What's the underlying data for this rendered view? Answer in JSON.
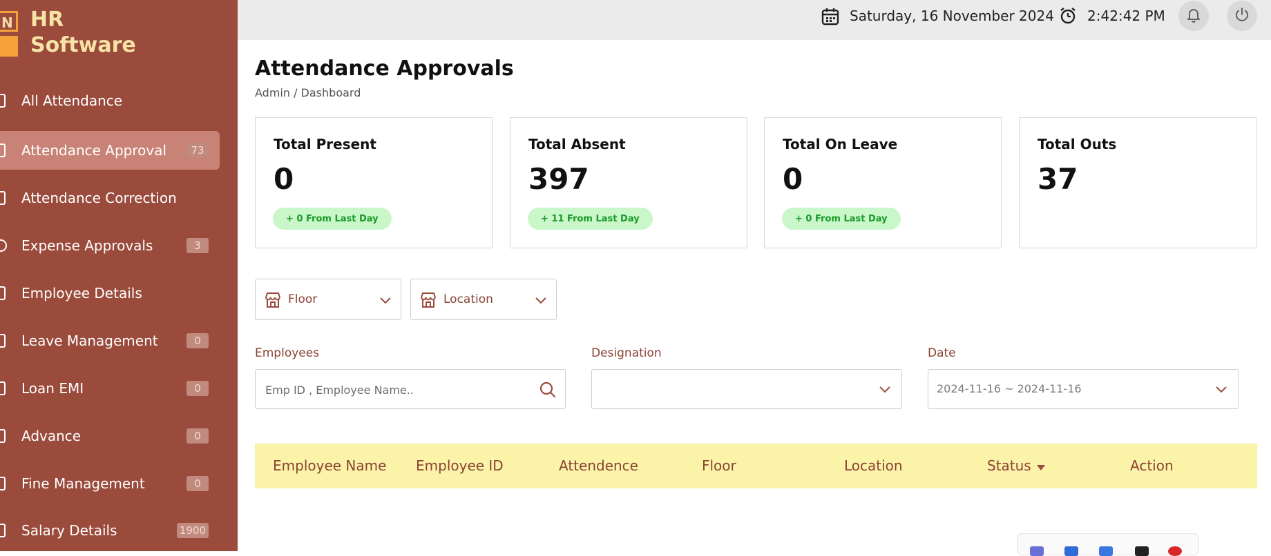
{
  "app": {
    "name_line1": "HR",
    "name_line2": "Software",
    "logo_letter": "N"
  },
  "sidebar": {
    "items": [
      {
        "label": "All Attendance",
        "badge": ""
      },
      {
        "label": "Attendance Approval",
        "badge": "73",
        "active": true
      },
      {
        "label": "Attendance Correction",
        "badge": ""
      },
      {
        "label": "Expense Approvals",
        "badge": "3"
      },
      {
        "label": "Employee Details",
        "badge": ""
      },
      {
        "label": "Leave Management",
        "badge": "0"
      },
      {
        "label": "Loan EMI",
        "badge": "0"
      },
      {
        "label": "Advance",
        "badge": "0"
      },
      {
        "label": "Fine Management",
        "badge": "0"
      },
      {
        "label": "Salary Details",
        "badge": "1900"
      }
    ]
  },
  "topbar": {
    "date": "Saturday, 16 November 2024",
    "time": "2:42:42 PM",
    "icons": [
      "calendar-icon",
      "alarm-clock-icon",
      "bell-icon",
      "power-icon"
    ]
  },
  "page": {
    "title": "Attendance Approvals",
    "breadcrumb": "Admin / Dashboard"
  },
  "stats": [
    {
      "label": "Total Present",
      "value": "0",
      "change": "+ 0 From Last Day"
    },
    {
      "label": "Total Absent",
      "value": "397",
      "change": "+ 11 From Last Day"
    },
    {
      "label": "Total On Leave",
      "value": "0",
      "change": "+ 0 From Last Day"
    },
    {
      "label": "Total Outs",
      "value": "37",
      "change": ""
    }
  ],
  "filters": {
    "floor": "Floor",
    "location": "Location",
    "employees_label": "Employees",
    "employees_placeholder": "Emp ID , Employee Name..",
    "designation_label": "Designation",
    "designation_value": "",
    "date_label": "Date",
    "date_value": "2024-11-16 ~ 2024-11-16"
  },
  "table": {
    "columns": [
      "Employee Name",
      "Employee ID",
      "Attendence",
      "Floor",
      "Location",
      "Status",
      "Action"
    ]
  },
  "colors": {
    "sidebar": "#9a4b3b",
    "accent_text": "#8a4334",
    "active_item": "#c98276",
    "table_header": "#fbf3a8",
    "positive": "#1a9a2a"
  }
}
